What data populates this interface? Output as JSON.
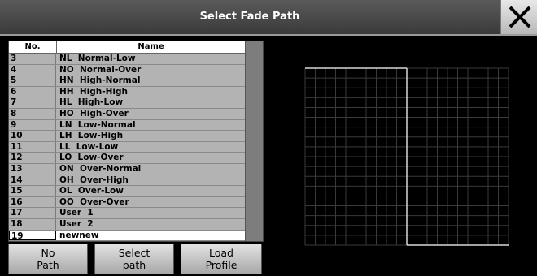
{
  "window": {
    "title": "Select Fade Path"
  },
  "table": {
    "columns": {
      "no": "No.",
      "name": "Name"
    },
    "rows": [
      {
        "no": "3",
        "name": "NL  Normal-Low"
      },
      {
        "no": "4",
        "name": "NO  Normal-Over"
      },
      {
        "no": "5",
        "name": "HN  High-Normal"
      },
      {
        "no": "6",
        "name": "HH  High-High"
      },
      {
        "no": "7",
        "name": "HL  High-Low"
      },
      {
        "no": "8",
        "name": "HO  High-Over"
      },
      {
        "no": "9",
        "name": "LN  Low-Normal"
      },
      {
        "no": "10",
        "name": "LH  Low-High"
      },
      {
        "no": "11",
        "name": "LL  Low-Low"
      },
      {
        "no": "12",
        "name": "LO  Low-Over"
      },
      {
        "no": "13",
        "name": "ON  Over-Normal"
      },
      {
        "no": "14",
        "name": "OH  Over-High"
      },
      {
        "no": "15",
        "name": "OL  Over-Low"
      },
      {
        "no": "16",
        "name": "OO  Over-Over"
      },
      {
        "no": "17",
        "name": "User  1"
      },
      {
        "no": "18",
        "name": "User  2"
      },
      {
        "no": "19",
        "name": "newnew",
        "selected": true
      }
    ]
  },
  "buttons": {
    "no_path": {
      "line1": "No",
      "line2": "Path"
    },
    "select_path": {
      "line1": "Select",
      "line2": "path"
    },
    "load_profile": {
      "line1": "Load",
      "line2": "Profile"
    }
  },
  "preview": {
    "grid_color": "#3a3a3a",
    "path_color": "#d8d8d8",
    "path_segments": [
      {
        "from": [
          0,
          0
        ],
        "to": [
          0.5,
          0
        ]
      },
      {
        "from": [
          0.5,
          0
        ],
        "to": [
          0.5,
          1
        ]
      },
      {
        "from": [
          0.5,
          1
        ],
        "to": [
          1,
          1
        ]
      }
    ]
  }
}
